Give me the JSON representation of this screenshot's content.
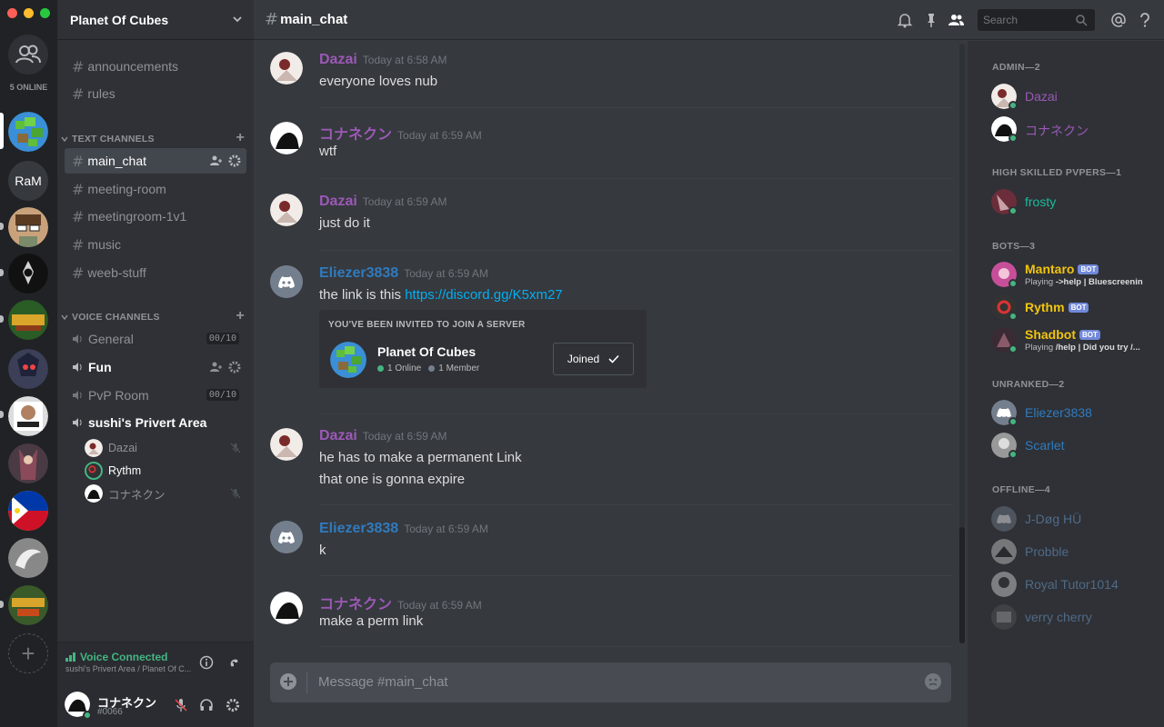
{
  "colors": {
    "bg": "#36393e",
    "sidebar": "#2f3136",
    "rail": "#202225",
    "online": "#43b581",
    "blurple": "#7289da",
    "link": "#00b0f4",
    "purple_name": "#9b59b6",
    "blue_name": "#2f7bbf",
    "teal_name": "#1abc9c",
    "yellow_name": "#f1c40f"
  },
  "rail": {
    "online_count": "5 ONLINE",
    "ram_label": "RaM"
  },
  "server": {
    "name": "Planet Of Cubes"
  },
  "channels": {
    "top": [
      {
        "name": "announcements"
      },
      {
        "name": "rules"
      }
    ],
    "text_category": "TEXT CHANNELS",
    "text": [
      {
        "name": "main_chat"
      },
      {
        "name": "meeting-room"
      },
      {
        "name": "meetingroom-1v1"
      },
      {
        "name": "music"
      },
      {
        "name": "weeb-stuff"
      }
    ],
    "voice_category": "VOICE CHANNELS",
    "voice": [
      {
        "name": "General",
        "count": "00/10"
      },
      {
        "name": "Fun"
      },
      {
        "name": "PvP Room",
        "count": "00/10"
      },
      {
        "name": "sushi's Privert Area"
      }
    ],
    "voice_users": [
      {
        "name": "Dazai"
      },
      {
        "name": "Rythm"
      },
      {
        "name": "コナネクン"
      }
    ]
  },
  "voice_panel": {
    "title": "Voice Connected",
    "subtitle": "sushi's Privert Area / Planet Of C..."
  },
  "user_panel": {
    "name": "コナネクン",
    "discriminator": "#0066"
  },
  "header": {
    "channel": "main_chat",
    "search_placeholder": "Search"
  },
  "messages": [
    {
      "author": "Dazai",
      "time": "Today at 6:58 AM",
      "lines": [
        "everyone loves nub"
      ]
    },
    {
      "author": "コナネクン",
      "time": "Today at 6:59 AM",
      "lines": [
        "wtf"
      ]
    },
    {
      "author": "Dazai",
      "time": "Today at 6:59 AM",
      "lines": [
        "just do it"
      ]
    },
    {
      "author": "Eliezer3838",
      "time": "Today at 6:59 AM",
      "text": "the link is this",
      "link": "https://discord.gg/K5xm27"
    },
    {
      "author": "Dazai",
      "time": "Today at 6:59 AM",
      "lines": [
        "he has to make a permanent Link",
        "that one is gonna expire"
      ]
    },
    {
      "author": "Eliezer3838",
      "time": "Today at 6:59 AM",
      "lines": [
        "k"
      ]
    },
    {
      "author": "コナネクン",
      "time": "Today at 6:59 AM",
      "lines": [
        "make a perm link"
      ]
    }
  ],
  "invite": {
    "heading": "YOU'VE BEEN INVITED TO JOIN A SERVER",
    "server": "Planet Of Cubes",
    "online": "1 Online",
    "members": "1 Member",
    "button": "Joined"
  },
  "composer": {
    "placeholder": "Message #main_chat"
  },
  "members": {
    "groups": [
      {
        "title": "ADMIN—2",
        "items": [
          {
            "name": "Dazai"
          },
          {
            "name": "コナネクン"
          }
        ]
      },
      {
        "title": "HIGH SKILLED PVPERS—1",
        "items": [
          {
            "name": "frosty"
          }
        ]
      },
      {
        "title": "BOTS—3",
        "items": [
          {
            "name": "Mantaro",
            "badge": "BOT",
            "activity_prefix": "Playing ",
            "activity": "->help | Bluescreenin..."
          },
          {
            "name": "Rythm",
            "badge": "BOT"
          },
          {
            "name": "Shadbot",
            "badge": "BOT",
            "activity_prefix": "Playing ",
            "activity": "/help | Did you try /..."
          }
        ]
      },
      {
        "title": "UNRANKED—2",
        "items": [
          {
            "name": "Eliezer3838"
          },
          {
            "name": "Scarlet"
          }
        ]
      },
      {
        "title": "OFFLINE—4",
        "items": [
          {
            "name": "J-Døg HÜ"
          },
          {
            "name": "Probble"
          },
          {
            "name": "Royal Tutor1014"
          },
          {
            "name": "verry cherry"
          }
        ]
      }
    ]
  }
}
